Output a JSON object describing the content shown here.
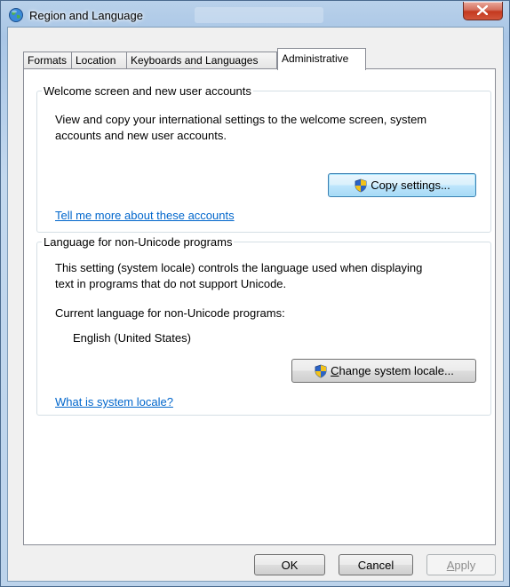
{
  "window": {
    "title": "Region and Language",
    "close_glyph": "✕"
  },
  "tabs": [
    {
      "label": "Formats"
    },
    {
      "label": "Location"
    },
    {
      "label": "Keyboards and Languages"
    },
    {
      "label": "Administrative"
    }
  ],
  "welcome": {
    "legend": "Welcome screen and new user accounts",
    "description_line1": "View and copy your international settings to the welcome screen, system",
    "description_line2": "accounts and new user accounts.",
    "copy_button": "Copy settings...",
    "link": "Tell me more about these accounts"
  },
  "nonunicode": {
    "legend": "Language for non-Unicode programs",
    "description_line1": "This setting (system locale) controls the language used when displaying",
    "description_line2": "text in programs that do not support Unicode.",
    "current_label": "Current language for non-Unicode programs:",
    "current_value": "English (United States)",
    "change_button": "Change system locale...",
    "link": "What is system locale?"
  },
  "footer": {
    "ok": "OK",
    "cancel": "Cancel",
    "apply": "Apply"
  }
}
